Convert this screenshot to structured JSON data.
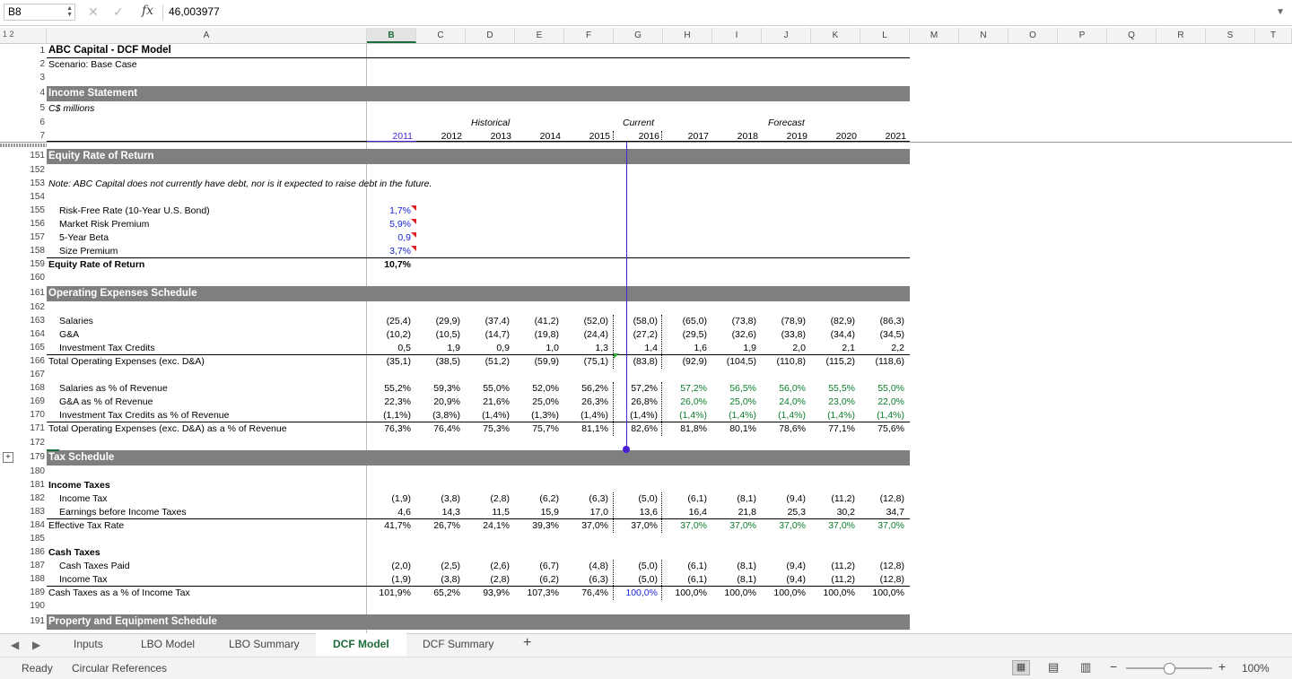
{
  "formula_bar": {
    "cell_ref": "B8",
    "fx": "fx",
    "value": "46,003977"
  },
  "columns": [
    "A",
    "B",
    "C",
    "D",
    "E",
    "F",
    "G",
    "H",
    "I",
    "J",
    "K",
    "L",
    "M",
    "N",
    "O",
    "P",
    "Q",
    "R",
    "S",
    "T"
  ],
  "outline_levels": "1 2",
  "frozen": {
    "title": "ABC Capital - DCF Model",
    "scenario": "Scenario: Base Case",
    "section": "Income Statement",
    "units": "C$ millions",
    "historical": "Historical",
    "current": "Current",
    "forecast": "Forecast",
    "years": [
      "2011",
      "2012",
      "2013",
      "2014",
      "2015",
      "2016",
      "2017",
      "2018",
      "2019",
      "2020",
      "2021"
    ]
  },
  "row_numbers": {
    "r1": "1",
    "r2": "2",
    "r3": "3",
    "r4": "4",
    "r5": "5",
    "r6": "6",
    "r7": "7",
    "r151": "151",
    "r152": "152",
    "r153": "153",
    "r154": "154",
    "r155": "155",
    "r156": "156",
    "r157": "157",
    "r158": "158",
    "r159": "159",
    "r160": "160",
    "r161": "161",
    "r162": "162",
    "r163": "163",
    "r164": "164",
    "r165": "165",
    "r166": "166",
    "r167": "167",
    "r168": "168",
    "r169": "169",
    "r170": "170",
    "r171": "171",
    "r172": "172",
    "r179": "179",
    "r180": "180",
    "r181": "181",
    "r182": "182",
    "r183": "183",
    "r184": "184",
    "r185": "185",
    "r186": "186",
    "r187": "187",
    "r188": "188",
    "r189": "189",
    "r190": "190",
    "r191": "191"
  },
  "equity": {
    "header": "Equity Rate of Return",
    "note": "Note: ABC Capital does not currently have debt, nor is it expected to raise debt in the future.",
    "rf_label": "Risk-Free Rate (10-Year U.S. Bond)",
    "rf": "1,7%",
    "mrp_label": "Market Risk Premium",
    "mrp": "5,9%",
    "beta_label": "5-Year Beta",
    "beta": "0,9",
    "size_label": "Size Premium",
    "size": "3,7%",
    "total_label": "Equity Rate of Return",
    "total": "10,7%"
  },
  "opex": {
    "header": "Operating Expenses Schedule",
    "rows": [
      {
        "label": "Salaries",
        "values": [
          "(25,4)",
          "(29,9)",
          "(37,4)",
          "(41,2)",
          "(52,0)",
          "(58,0)",
          "(65,0)",
          "(73,8)",
          "(78,9)",
          "(82,9)",
          "(86,3)"
        ]
      },
      {
        "label": "G&A",
        "values": [
          "(10,2)",
          "(10,5)",
          "(14,7)",
          "(19,8)",
          "(24,4)",
          "(27,2)",
          "(29,5)",
          "(32,6)",
          "(33,8)",
          "(34,4)",
          "(34,5)"
        ]
      },
      {
        "label": "Investment Tax Credits",
        "values": [
          "0,5",
          "1,9",
          "0,9",
          "1,0",
          "1,3",
          "1,4",
          "1,6",
          "1,9",
          "2,0",
          "2,1",
          "2,2"
        ]
      },
      {
        "label": "Total Operating Expenses (exc. D&A)",
        "values": [
          "(35,1)",
          "(38,5)",
          "(51,2)",
          "(59,9)",
          "(75,1)",
          "(83,8)",
          "(92,9)",
          "(104,5)",
          "(110,8)",
          "(115,2)",
          "(118,6)"
        ]
      },
      {
        "label": "Salaries as % of Revenue",
        "values": [
          "55,2%",
          "59,3%",
          "55,0%",
          "52,0%",
          "56,2%",
          "57,2%",
          "57,2%",
          "56,5%",
          "56,0%",
          "55,5%",
          "55,0%"
        ]
      },
      {
        "label": "G&A as % of Revenue",
        "values": [
          "22,3%",
          "20,9%",
          "21,6%",
          "25,0%",
          "26,3%",
          "26,8%",
          "26,0%",
          "25,0%",
          "24,0%",
          "23,0%",
          "22,0%"
        ]
      },
      {
        "label": "Investment Tax Credits as % of Revenue",
        "values": [
          "(1,1%)",
          "(3,8%)",
          "(1,4%)",
          "(1,3%)",
          "(1,4%)",
          "(1,4%)",
          "(1,4%)",
          "(1,4%)",
          "(1,4%)",
          "(1,4%)",
          "(1,4%)"
        ]
      },
      {
        "label": "Total Operating Expenses (exc. D&A) as a % of Revenue",
        "values": [
          "76,3%",
          "76,4%",
          "75,3%",
          "75,7%",
          "81,1%",
          "82,6%",
          "81,8%",
          "80,1%",
          "78,6%",
          "77,1%",
          "75,6%"
        ]
      }
    ]
  },
  "tax": {
    "header": "Tax Schedule",
    "income_taxes": "Income Taxes",
    "cash_taxes": "Cash Taxes",
    "rows": [
      {
        "label": "Income Tax",
        "values": [
          "(1,9)",
          "(3,8)",
          "(2,8)",
          "(6,2)",
          "(6,3)",
          "(5,0)",
          "(6,1)",
          "(8,1)",
          "(9,4)",
          "(11,2)",
          "(12,8)"
        ]
      },
      {
        "label": "Earnings before Income Taxes",
        "values": [
          "4,6",
          "14,3",
          "11,5",
          "15,9",
          "17,0",
          "13,6",
          "16,4",
          "21,8",
          "25,3",
          "30,2",
          "34,7"
        ]
      },
      {
        "label": "Effective Tax Rate",
        "values": [
          "41,7%",
          "26,7%",
          "24,1%",
          "39,3%",
          "37,0%",
          "37,0%",
          "37,0%",
          "37,0%",
          "37,0%",
          "37,0%",
          "37,0%"
        ]
      },
      {
        "label": "Cash Taxes Paid",
        "values": [
          "(2,0)",
          "(2,5)",
          "(2,6)",
          "(6,7)",
          "(4,8)",
          "(5,0)",
          "(6,1)",
          "(8,1)",
          "(9,4)",
          "(11,2)",
          "(12,8)"
        ]
      },
      {
        "label": "Income Tax",
        "values": [
          "(1,9)",
          "(3,8)",
          "(2,8)",
          "(6,2)",
          "(6,3)",
          "(5,0)",
          "(6,1)",
          "(8,1)",
          "(9,4)",
          "(11,2)",
          "(12,8)"
        ]
      },
      {
        "label": "Cash Taxes as a % of Income Tax",
        "values": [
          "101,9%",
          "65,2%",
          "93,9%",
          "107,3%",
          "76,4%",
          "100,0%",
          "100,0%",
          "100,0%",
          "100,0%",
          "100,0%",
          "100,0%"
        ]
      }
    ]
  },
  "ppe": {
    "header": "Property and Equipment Schedule"
  },
  "sheet_tabs": [
    "Inputs",
    "LBO Model",
    "LBO Summary",
    "DCF Model",
    "DCF Summary"
  ],
  "active_tab": "DCF Model",
  "add_sheet": "+",
  "status": {
    "ready": "Ready",
    "circular": "Circular References",
    "zoom": "100%"
  },
  "colors": {
    "band": "#7f7f7f",
    "accent": "#1b6d3b",
    "input_blue": "#1a26d6",
    "forecast_green": "#0b7d2c",
    "trace_purple": "#4a1fd6"
  }
}
